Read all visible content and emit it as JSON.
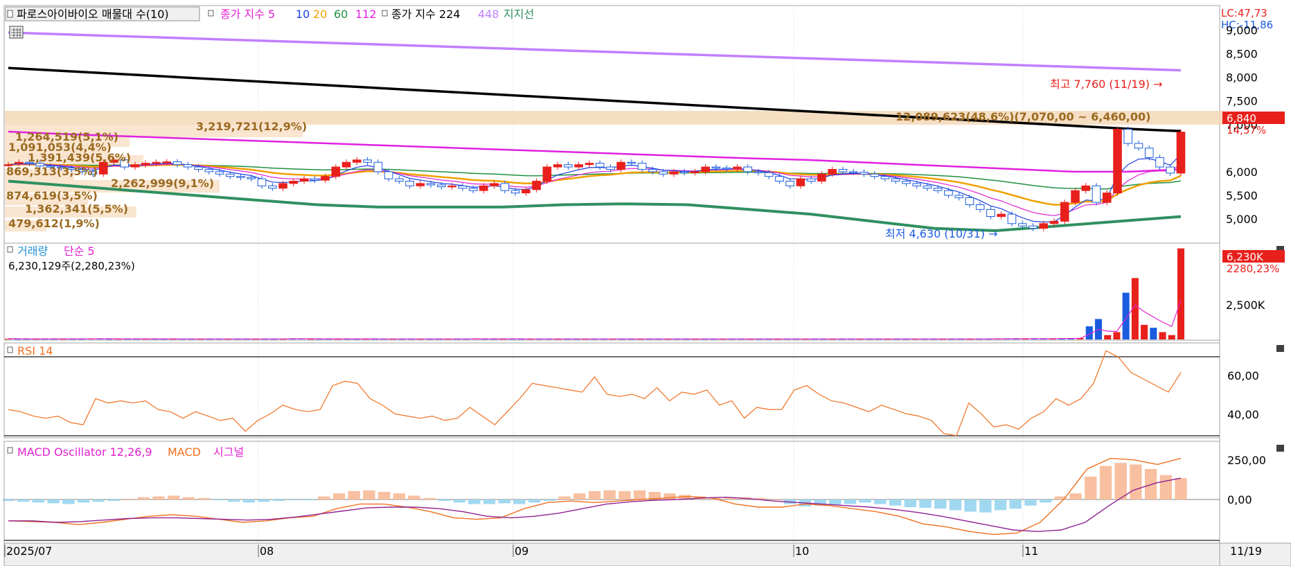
{
  "legend": {
    "price_title": "파로스아이바이오 매물대 수(10)",
    "ema_label": "종가 지수 5",
    "ema_10": "10",
    "ema_20": "20",
    "ema_60": "60",
    "ema_112": "112",
    "ema_label2": "종가 지수 224",
    "ema_448": "448",
    "support": "지지선",
    "volume_title": "거래량",
    "volume_ma": "단순 5",
    "volume_value": "6,230,129주(2,280,23%)",
    "rsi_title": "RSI 14",
    "macd_osc": "MACD Oscillator 12,26,9",
    "macd": "MACD",
    "signal": "시그널"
  },
  "right_info": {
    "lc": "LC:47,73",
    "hc": "HC:-11,86",
    "price_badge": "6,840",
    "price_change": "14,57%",
    "volume_badge": "6,230K",
    "volume_change": "2280,23%"
  },
  "annotations": {
    "high": "최고 7,760 (11/19) →",
    "low": "최저 4,630 (10/31) →",
    "vp_big": "12,089,623(48,6%)(7,070,00 ~ 6,460,00)",
    "vp_1": "3,219,721(12,9%)",
    "vp_2": "1,264,519(5,1%)",
    "vp_3": "1,091,053(4,4%)",
    "vp_4": "1,391,439(5,6%)",
    "vp_5": "869,313(3,5%)",
    "vp_6": "2,262,999(9,1%)",
    "vp_7": "874,619(3,5%)",
    "vp_8": "1,362,341(5,5%)",
    "vp_9": "479,612(1,9%)"
  },
  "colors": {
    "up": "#e8201c",
    "down": "#1a5ce0",
    "ema5": "#2040e0",
    "ema10": "#e020d0",
    "ema20": "#f0a000",
    "ema60": "#209040",
    "ema112": "#e020e0",
    "ema224": "#000000",
    "ema448": "#c080ff",
    "support": "#309060",
    "rsi": "#f07020",
    "macd": "#f07020",
    "signal": "#902090",
    "osc_pos": "#f8c0a0",
    "osc_neg": "#a0d8f0"
  },
  "chart_data": [
    {
      "type": "candlestick",
      "pane": "price",
      "x_ticks": [
        "2025/07",
        "08",
        "09",
        "10",
        "11",
        "11/19"
      ],
      "y_ticks": [
        "9,000",
        "8,500",
        "8,000",
        "7,500",
        "7,000",
        "6,000",
        "5,500",
        "5,000"
      ],
      "ylim": [
        4500,
        9200
      ],
      "high": {
        "value": 7760,
        "date": "11/19"
      },
      "low": {
        "value": 4630,
        "date": "10/31"
      },
      "last_close": 6840,
      "volume_profile_labels": [
        "3,219,721(12,9%)",
        "1,264,519(5,1%)",
        "1,091,053(4,4%)",
        "1,391,439(5,6%)",
        "869,313(3,5%)",
        "2,262,999(9,1%)",
        "874,619(3,5%)",
        "1,362,341(5,5%)",
        "479,612(1,9%)",
        "12,089,623(48,6%)"
      ],
      "close": [
        6150,
        6200,
        6180,
        6120,
        6100,
        6080,
        6050,
        6000,
        5950,
        6200,
        6250,
        6100,
        6150,
        6180,
        6200,
        6210,
        6150,
        6100,
        6050,
        6000,
        5950,
        5900,
        5880,
        5850,
        5700,
        5650,
        5750,
        5800,
        5850,
        5820,
        5900,
        6100,
        6200,
        6250,
        6200,
        6000,
        5850,
        5800,
        5700,
        5750,
        5720,
        5680,
        5700,
        5650,
        5600,
        5700,
        5750,
        5600,
        5550,
        5620,
        5800,
        6100,
        6150,
        6100,
        6150,
        6180,
        6100,
        6050,
        6200,
        6180,
        6050,
        6000,
        5950,
        6000,
        5980,
        6000,
        6100,
        6080,
        6060,
        6100,
        6000,
        5980,
        5900,
        5800,
        5700,
        5850,
        5800,
        5950,
        6050,
        6000,
        5990,
        5950,
        5900,
        5850,
        5800,
        5750,
        5700,
        5650,
        5600,
        5500,
        5450,
        5300,
        5200,
        5050,
        5100,
        4900,
        4850,
        4800,
        4900,
        4950,
        5350,
        5600,
        5700,
        5350,
        5550,
        6900,
        6600,
        6500,
        6300,
        6100,
        5970,
        6840
      ],
      "open": [
        6150,
        6180,
        6200,
        6180,
        6120,
        6100,
        6080,
        6050,
        6000,
        5950,
        6200,
        6250,
        6100,
        6150,
        6180,
        6200,
        6210,
        6150,
        6100,
        6050,
        6000,
        5950,
        5900,
        5880,
        5850,
        5700,
        5650,
        5750,
        5800,
        5850,
        5820,
        5900,
        6100,
        6200,
        6250,
        6200,
        6000,
        5850,
        5800,
        5700,
        5750,
        5720,
        5680,
        5700,
        5650,
        5600,
        5700,
        5750,
        5600,
        5550,
        5620,
        5800,
        6100,
        6150,
        6100,
        6150,
        6180,
        6100,
        6050,
        6200,
        6180,
        6050,
        6000,
        5950,
        6000,
        5980,
        6000,
        6100,
        6080,
        6060,
        6100,
        6000,
        5980,
        5900,
        5800,
        5700,
        5850,
        5800,
        5950,
        6050,
        6000,
        5990,
        5950,
        5900,
        5850,
        5800,
        5750,
        5700,
        5650,
        5600,
        5500,
        5450,
        5300,
        5200,
        5050,
        5100,
        4900,
        4850,
        4800,
        4900,
        4950,
        5350,
        5600,
        5700,
        5350,
        5550,
        6900,
        6600,
        6500,
        6300,
        6100,
        5970
      ],
      "series_ma": {
        "ema224": [
          8200,
          8150,
          8100,
          8050,
          8000,
          7950,
          7900,
          7850,
          7800,
          7750,
          7700,
          7650,
          7600,
          7550,
          7500,
          7450,
          7400,
          7350,
          7300,
          7250,
          7200,
          7150,
          7100,
          7050,
          7000,
          6950,
          6900,
          6860
        ],
        "ema448": [
          8950,
          8900,
          8850,
          8800,
          8750,
          8700,
          8650,
          8600,
          8550,
          8500,
          8450,
          8400,
          8350,
          8300,
          8250,
          8200,
          8150
        ],
        "ema112": [
          6850,
          6800,
          6760,
          6720,
          6680,
          6640,
          6600,
          6560,
          6520,
          6480,
          6440,
          6400,
          6360,
          6320,
          6280,
          6250,
          6200,
          6150,
          6100,
          6050,
          6000,
          6000,
          6050
        ],
        "support": [
          5800,
          5700,
          5600,
          5500,
          5400,
          5300,
          5250,
          5250,
          5250,
          5300,
          5320,
          5300,
          5200,
          5100,
          4950,
          4800,
          4750,
          4850,
          4950,
          5050
        ]
      }
    },
    {
      "type": "bar",
      "pane": "volume",
      "y_ticks": [
        "2,500K"
      ],
      "last_volume": "6,230K",
      "values_k": [
        50,
        40,
        40,
        40,
        40,
        40,
        40,
        40,
        40,
        50,
        60,
        40,
        40,
        40,
        40,
        40,
        40,
        40,
        40,
        40,
        40,
        40,
        40,
        40,
        40,
        40,
        40,
        40,
        40,
        40,
        40,
        60,
        50,
        40,
        40,
        40,
        40,
        40,
        40,
        40,
        40,
        40,
        40,
        40,
        40,
        40,
        40,
        40,
        40,
        40,
        40,
        50,
        40,
        40,
        40,
        40,
        40,
        40,
        40,
        40,
        40,
        40,
        40,
        40,
        40,
        40,
        40,
        40,
        40,
        40,
        40,
        40,
        40,
        40,
        40,
        40,
        40,
        40,
        40,
        40,
        40,
        40,
        40,
        40,
        40,
        40,
        40,
        40,
        40,
        40,
        40,
        40,
        40,
        40,
        40,
        40,
        40,
        40,
        40,
        40,
        40,
        40,
        40,
        40,
        40,
        40,
        40,
        40,
        50,
        60,
        60,
        60,
        60,
        50,
        60,
        70,
        80,
        90,
        900,
        1400,
        300,
        500,
        3200,
        4200,
        1000,
        800,
        500,
        300,
        6230
      ]
    },
    {
      "type": "line",
      "pane": "rsi",
      "y_ticks": [
        "60,00",
        "40,00"
      ],
      "ylim": [
        30,
        72
      ],
      "values": [
        43,
        42,
        40,
        39,
        40,
        37,
        36,
        48,
        46,
        47,
        46,
        47,
        43,
        42,
        39,
        42,
        40,
        38,
        39,
        33,
        38,
        41,
        45,
        43,
        42,
        43,
        54,
        56,
        55,
        48,
        45,
        41,
        40,
        39,
        40,
        38,
        39,
        44,
        40,
        36,
        42,
        48,
        55,
        54,
        53,
        52,
        51,
        58,
        50,
        49,
        50,
        48,
        53,
        47,
        51,
        50,
        52,
        45,
        47,
        39,
        44,
        43,
        43,
        52,
        54,
        50,
        47,
        46,
        44,
        42,
        45,
        43,
        41,
        40,
        38,
        32,
        31,
        46,
        41,
        35,
        36,
        34,
        39,
        42,
        48,
        45,
        48,
        55,
        70,
        67,
        60,
        57,
        54,
        51,
        60
      ]
    },
    {
      "type": "bar+line",
      "pane": "macd",
      "y_ticks": [
        "250,00",
        "0,00"
      ],
      "series": [
        {
          "name": "MACD Oscillator 12,26,9",
          "kind": "bar",
          "values": [
            -10,
            -15,
            -20,
            -25,
            -30,
            -20,
            -15,
            -10,
            5,
            15,
            20,
            25,
            15,
            10,
            -5,
            -15,
            -20,
            -15,
            -10,
            -5,
            -5,
            20,
            40,
            55,
            60,
            50,
            40,
            25,
            10,
            -10,
            -20,
            -30,
            -30,
            -25,
            -30,
            -20,
            -10,
            20,
            40,
            55,
            60,
            55,
            60,
            50,
            40,
            30,
            20,
            10,
            10,
            15,
            10,
            0,
            -30,
            -45,
            -40,
            -35,
            -30,
            -20,
            -30,
            -40,
            -50,
            -55,
            -60,
            -70,
            -80,
            -85,
            -70,
            -60,
            -40,
            -20,
            20,
            40,
            150,
            220,
            240,
            230,
            200,
            160,
            140
          ]
        },
        {
          "name": "MACD",
          "kind": "line",
          "values": [
            -140,
            -145,
            -150,
            -165,
            -150,
            -130,
            -110,
            -100,
            -110,
            -130,
            -150,
            -140,
            -120,
            -110,
            -60,
            -30,
            -30,
            -50,
            -80,
            -120,
            -130,
            -120,
            -60,
            -20,
            -10,
            -20,
            -10,
            0,
            10,
            20,
            10,
            -30,
            -50,
            -50,
            -30,
            -40,
            -60,
            -80,
            -110,
            -160,
            -180,
            -210,
            -230,
            -220,
            -150,
            0,
            200,
            270,
            260,
            230,
            270
          ]
        },
        {
          "name": "시그널",
          "kind": "line",
          "values": [
            -140,
            -140,
            -150,
            -145,
            -135,
            -125,
            -120,
            -120,
            -125,
            -130,
            -135,
            -130,
            -115,
            -95,
            -75,
            -55,
            -50,
            -50,
            -60,
            -80,
            -110,
            -120,
            -110,
            -90,
            -60,
            -30,
            -15,
            -5,
            0,
            10,
            15,
            5,
            -10,
            -20,
            -30,
            -40,
            -50,
            -65,
            -85,
            -110,
            -140,
            -170,
            -200,
            -210,
            -200,
            -150,
            -40,
            60,
            110,
            140
          ]
        }
      ]
    }
  ]
}
